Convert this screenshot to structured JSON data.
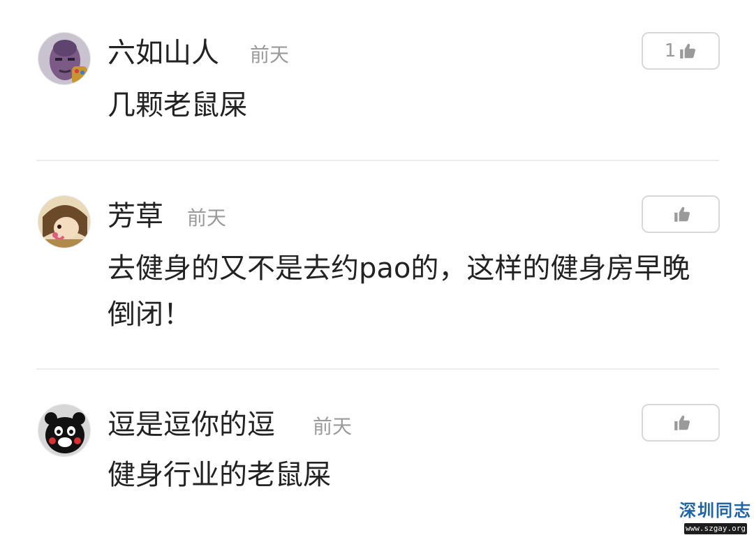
{
  "comments": [
    {
      "username": "六如山人",
      "time": "前天",
      "content": "几颗老鼠屎",
      "like_count": "1",
      "avatar": "avatar-thanos-icon"
    },
    {
      "username": "芳草",
      "time": "前天",
      "content": "去健身的又不是去约pao的，这样的健身房早晚倒闭！",
      "like_count": "",
      "avatar": "avatar-cartoon-girl-icon"
    },
    {
      "username": "逗是逗你的逗",
      "time": "前天",
      "content": "健身行业的老鼠屎",
      "like_count": "",
      "avatar": "avatar-kumamon-icon"
    }
  ],
  "icons": {
    "like": "thumbs-up-icon"
  },
  "watermark": {
    "title": "深圳同志",
    "url": "www.szgay.org"
  },
  "colors": {
    "text": "#222222",
    "muted": "#9a9a9a",
    "border": "#d8d8d8",
    "divider": "#ececec",
    "watermark": "#1f63a8"
  }
}
